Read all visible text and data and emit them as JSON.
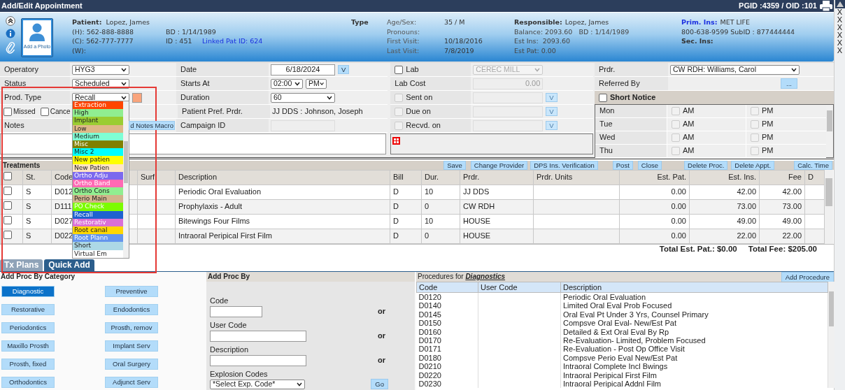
{
  "window": {
    "title": "Add/Edit Appointment",
    "ids": "PGID :4359  / OID :101"
  },
  "side_strip": [
    "X",
    "X",
    "X",
    "X",
    "X",
    "X"
  ],
  "patient": {
    "photo_caption": "Add a Photo",
    "patient_label": "Patient:",
    "patient_name": "Lopez, James",
    "home": "(H): 562-888-8888",
    "cell": "(C):  562-777-7777",
    "work": "(W):",
    "bd": "BD : 1/14/1989",
    "id": "ID : 451",
    "linked": "Linked Pat ID: 624",
    "type_label": "Type",
    "facts": [
      {
        "label": "Age/Sex:",
        "value": "35 / M"
      },
      {
        "label": "Pronouns:"
      },
      {
        "label": "First Visit:",
        "value": "10/18/2016"
      },
      {
        "label": "Last Visit:",
        "value": "7/8/2019"
      }
    ],
    "responsible": {
      "label": "Responsible:",
      "name": "Lopez, James",
      "lines": [
        "Balance: 2093.60   BD : 1/14/1989",
        "Est Ins:  2093.60",
        "Est Pat: 0.00"
      ]
    },
    "insurance": {
      "prim_label": "Prim. Ins:",
      "prim": "MET LIFE",
      "line": "800-638-9599 SubID : 877444444",
      "sec_label": "Sec. Ins:"
    }
  },
  "form": {
    "operatory": {
      "label": "Operatory",
      "value": "HYG3"
    },
    "status": {
      "label": "Status",
      "value": "Scheduled"
    },
    "prod_type": {
      "label": "Prod. Type",
      "value": "Recall",
      "color": "#f9a47c"
    },
    "flags": [
      {
        "label": "Missed",
        "checked": false
      },
      {
        "label": "Cance",
        "checked": false
      }
    ],
    "notes": {
      "label": "Notes",
      "macro_button": "d Notes Macro"
    },
    "date": {
      "label": "Date",
      "value": "6/18/2024",
      "button": "V"
    },
    "starts_at": {
      "label": "Starts At",
      "time": "02:00",
      "ampm": "PM"
    },
    "duration": {
      "label": "Duration",
      "value": "60"
    },
    "pref_prdr": {
      "label": "Patient Pref. Prdr.",
      "value": "JJ DDS : Johnson, Joseph"
    },
    "campaign": {
      "label": "Campaign ID",
      "disabled": true
    },
    "lab": {
      "label": "Lab",
      "checked": false,
      "value": "CEREC MILL",
      "disabled": true
    },
    "lab_cost": {
      "label": "Lab Cost",
      "value": "0.00",
      "disabled": true
    },
    "lab_dates": [
      {
        "label": "Sent on",
        "checked": false,
        "disabled": true,
        "button": "V"
      },
      {
        "label": "Due on",
        "checked": false,
        "disabled": true,
        "button": "V"
      },
      {
        "label": "Recvd. on",
        "checked": false,
        "disabled": true,
        "button": "V"
      }
    ],
    "prdr": {
      "label": "Prdr.",
      "value": "CW RDH: Williams, Carol"
    },
    "referred_by": {
      "label": "Referred By",
      "button": "..."
    },
    "short_notice": {
      "label": "Short Notice",
      "checked": false
    },
    "days": [
      {
        "day": "Mon",
        "am": {
          "label": "AM",
          "checked": false,
          "disabled": true
        },
        "pm": {
          "label": "PM",
          "checked": false,
          "disabled": true
        }
      },
      {
        "day": "Tue",
        "am": {
          "label": "AM",
          "checked": false,
          "disabled": true
        },
        "pm": {
          "label": "PM",
          "checked": false,
          "disabled": true
        }
      },
      {
        "day": "Wed",
        "am": {
          "label": "AM",
          "checked": false,
          "disabled": true
        },
        "pm": {
          "label": "PM",
          "checked": false,
          "disabled": true
        }
      },
      {
        "day": "Thu",
        "am": {
          "label": "AM",
          "checked": false,
          "disabled": true
        },
        "pm": {
          "label": "PM",
          "checked": false,
          "disabled": true
        }
      }
    ]
  },
  "prod_type_options": [
    {
      "label": "Extraction",
      "color": "#ff4500",
      "light_text": true
    },
    {
      "label": "High",
      "color": "#90ee90",
      "light_text": false
    },
    {
      "label": "Implant",
      "color": "#9acd32",
      "light_text": false
    },
    {
      "label": "Low",
      "color": "#deb887",
      "light_text": false
    },
    {
      "label": "Medium",
      "color": "#7fffd4",
      "light_text": false
    },
    {
      "label": "Misc",
      "color": "#808000",
      "light_text": true
    },
    {
      "label": "Misc 2",
      "color": "#00ffff",
      "light_text": false
    },
    {
      "label": "New patien",
      "color": "#ffff00",
      "light_text": false
    },
    {
      "label": "New Patien",
      "color": "#ffe4c4",
      "light_text": false
    },
    {
      "label": "Ortho Adju",
      "color": "#7b68ee",
      "light_text": true
    },
    {
      "label": "Ortho Band",
      "color": "#ff69b4",
      "light_text": true
    },
    {
      "label": "Ortho Cons",
      "color": "#90ee90",
      "light_text": false
    },
    {
      "label": "Perio Main",
      "color": "#d2b48c",
      "light_text": false
    },
    {
      "label": "PO Check",
      "color": "#7cfc00",
      "light_text": true
    },
    {
      "label": "Recall",
      "color": "#1e62d0",
      "light_text": true
    },
    {
      "label": "Restorativ",
      "color": "#da70d6",
      "light_text": true
    },
    {
      "label": "Root canal",
      "color": "#ffd700",
      "light_text": false
    },
    {
      "label": "Root Plann",
      "color": "#6495ed",
      "light_text": true
    },
    {
      "label": "Short",
      "color": "#add8e6",
      "light_text": false
    },
    {
      "label": "Virtual Em",
      "color": "#ffffff",
      "light_text": false
    }
  ],
  "treatments": {
    "title": "Treatments",
    "select_all_checked": false,
    "buttons": [
      "Save",
      "Change Provider",
      "DPS Ins. Verification",
      "Post",
      "Close",
      "Delete Proc.",
      "Delete Appt.",
      "Calc. Time"
    ],
    "columns": [
      "St.",
      "Code",
      "Surf",
      "Description",
      "Bill",
      "Dur.",
      "Prdr.",
      "Prdr. Units",
      "Est. Pat.",
      "Est. Ins.",
      "Fee",
      "D"
    ],
    "rows": [
      {
        "checked": false,
        "st": "S",
        "code": "D012",
        "description": "Periodic Oral Evaluation",
        "bill": "D",
        "dur": "10",
        "prdr": "JJ DDS",
        "est_pat": "0.00",
        "est_ins": "42.00",
        "fee": "42.00"
      },
      {
        "checked": false,
        "st": "S",
        "code": "D111",
        "description": "Prophylaxis - Adult",
        "bill": "D",
        "dur": "0",
        "prdr": "CW RDH",
        "est_pat": "0.00",
        "est_ins": "73.00",
        "fee": "73.00"
      },
      {
        "checked": false,
        "st": "S",
        "code": "D027",
        "description": "Bitewings Four Films",
        "bill": "D",
        "dur": "10",
        "prdr": "HOUSE",
        "est_pat": "0.00",
        "est_ins": "49.00",
        "fee": "49.00"
      },
      {
        "checked": false,
        "st": "S",
        "code": "D022",
        "description": "Intraoral Peripical First Film",
        "bill": "D",
        "dur": "0",
        "prdr": "HOUSE",
        "est_pat": "0.00",
        "est_ins": "22.00",
        "fee": "22.00"
      }
    ],
    "total_est_pat": "Total Est. Pat.: $0.00",
    "total_fee": "Total Fee: $205.00"
  },
  "tabs": [
    {
      "label": "Tx Plans",
      "selected": false
    },
    {
      "label": "Quick Add",
      "selected": true
    }
  ],
  "categories": {
    "title": "Add Proc By Category",
    "items": [
      {
        "label": "Diagnostic",
        "selected": true
      },
      {
        "label": "Preventive",
        "selected": false
      },
      {
        "label": "Restorative",
        "selected": false
      },
      {
        "label": "Endodontics",
        "selected": false
      },
      {
        "label": "Periodontics",
        "selected": false
      },
      {
        "label": "Prosth, remov",
        "selected": false
      },
      {
        "label": "Maxillo Prosth",
        "selected": false
      },
      {
        "label": "Implant Serv",
        "selected": false
      },
      {
        "label": "Prosth, fixed",
        "selected": false
      },
      {
        "label": "Oral Surgery",
        "selected": false
      },
      {
        "label": "Orthodontics",
        "selected": false
      },
      {
        "label": "Adjunct Serv",
        "selected": false
      }
    ]
  },
  "add_proc_by": {
    "title": "Add Proc By",
    "fields": [
      {
        "label": "Code",
        "or": "or"
      },
      {
        "label": "User Code",
        "or": "or"
      },
      {
        "label": "Description",
        "or": "or"
      }
    ],
    "explosion": {
      "label": "Explosion Codes",
      "value": "*Select Exp. Code*",
      "button": "Go"
    }
  },
  "procedures": {
    "title": "Procedures for *Diagnostics*",
    "button": "Add Procedure",
    "columns": [
      "Code",
      "User Code",
      "Description"
    ],
    "rows": [
      {
        "code": "D0120",
        "description": "Periodic Oral Evaluation"
      },
      {
        "code": "D0140",
        "description": "Limited Oral Eval Prob Focused"
      },
      {
        "code": "D0145",
        "description": "Oral Eval Pt Under 3 Yrs, Counsel Primary"
      },
      {
        "code": "D0150",
        "description": "Compsve Oral Eval- New/Est Pat"
      },
      {
        "code": "D0160",
        "description": "Detailed & Ext Oral Eval By Rp"
      },
      {
        "code": "D0170",
        "description": "Re-Evaluation- Limited, Problem Focused"
      },
      {
        "code": "D0171",
        "description": "Re-Evaluation - Post Op Office Visit"
      },
      {
        "code": "D0180",
        "description": "Compsve Perio Eval New/Est Pat"
      },
      {
        "code": "D0210",
        "description": "Intraoral Complete Incl Bwings"
      },
      {
        "code": "D0220",
        "description": "Intraoral Peripical First Film"
      },
      {
        "code": "D0230",
        "description": "Intraoral Peripical Addnl Film"
      }
    ]
  }
}
